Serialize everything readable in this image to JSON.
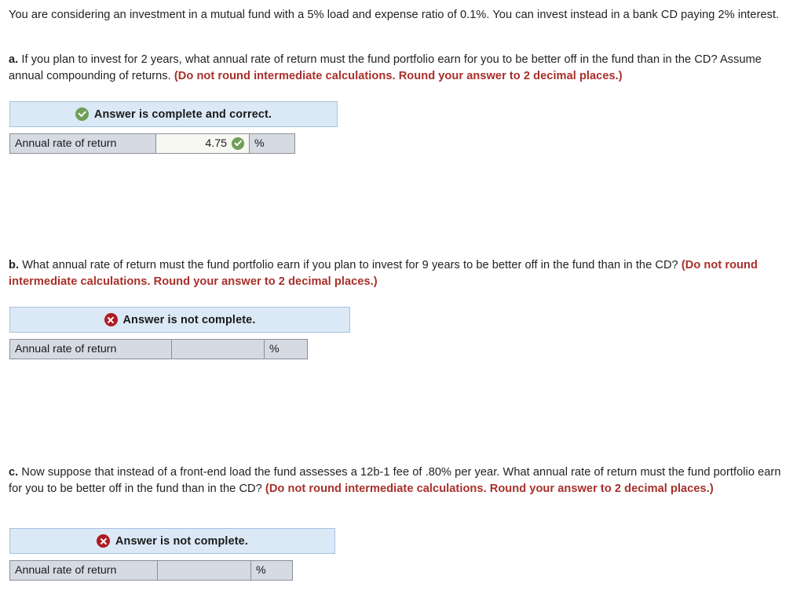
{
  "intro": {
    "paragraph": "You are considering an investment in a mutual fund with a 5% load and expense ratio of 0.1%. You can invest instead in a bank CD paying 2% interest."
  },
  "parts": [
    {
      "letter": "a.",
      "question": "If you plan to invest for 2 years, what annual rate of return must the fund portfolio earn for you to be better off in the fund than in the CD? Assume annual compounding of returns.",
      "instruction": "(Do not round intermediate calculations. Round your answer to 2 decimal places.)",
      "status": {
        "text": "Answer is complete and correct.",
        "icon": "check-circle-icon",
        "state": "correct"
      },
      "table": {
        "label": "Annual rate of return",
        "value": "4.75",
        "unit": "%",
        "value_icon": "check-circle-icon"
      }
    },
    {
      "letter": "b.",
      "question": "What annual rate of return must the fund portfolio earn if you plan to invest for 9 years to be better off in the fund than in the CD?",
      "instruction": "(Do not round intermediate calculations. Round your answer to 2 decimal places.)",
      "status": {
        "text": "Answer is not complete.",
        "icon": "x-circle-icon",
        "state": "incomplete"
      },
      "table": {
        "label": "Annual rate of return",
        "value": "",
        "unit": "%",
        "value_icon": ""
      }
    },
    {
      "letter": "c.",
      "question": "Now suppose that instead of a front-end load the fund assesses a 12b-1 fee of .80% per year. What annual rate of return must the fund portfolio earn for you to be better off in the fund than in the CD?",
      "instruction": "(Do not round intermediate calculations. Round your answer to 2 decimal places.)",
      "status": {
        "text": "Answer is not complete.",
        "icon": "x-circle-icon",
        "state": "incomplete"
      },
      "table": {
        "label": "Annual rate of return",
        "value": "",
        "unit": "%",
        "value_icon": ""
      }
    }
  ],
  "colors": {
    "banner_bg": "#dbe9f6",
    "banner_border": "#a6c3e0",
    "red_emphasis": "#a8302a",
    "correct_green": "#6f9e57",
    "incorrect_red": "#b01b22",
    "cell_bg": "#d5dae3",
    "cell_value_bg": "#f7f8f2",
    "cell_border": "#8b8f96"
  }
}
